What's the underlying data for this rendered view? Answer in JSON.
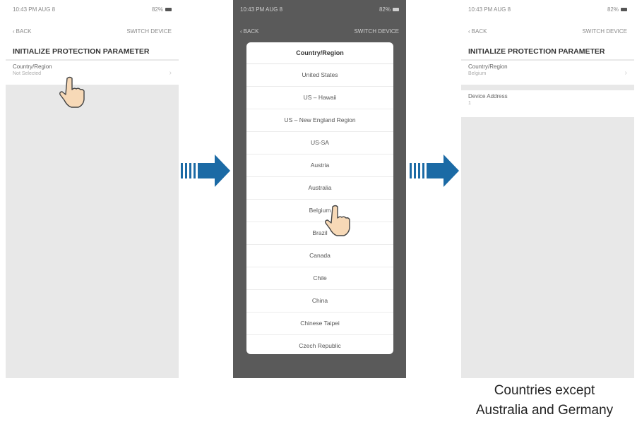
{
  "left_screen": {
    "status": {
      "left": "10:43 PM AUG 8",
      "right": "82%"
    },
    "nav": {
      "back_label": "BACK",
      "title": "SWITCH DEVICE"
    },
    "page_title": "INITIALIZE PROTECTION PARAMETER",
    "country_row": {
      "label": "Country/Region",
      "value": "Not Selected"
    }
  },
  "middle_screen": {
    "status": {
      "left": "10:43 PM AUG 8",
      "right": "82%"
    },
    "nav": {
      "back_label": "BACK",
      "title": "SWITCH DEVICE"
    },
    "modal_title": "Country/Region",
    "options": [
      "United States",
      "US – Hawaii",
      "US – New England Region",
      "US-SA",
      "Austria",
      "Australia",
      "Belgium",
      "Brazil",
      "Canada",
      "Chile",
      "China",
      "Chinese Taipei",
      "Czech Republic"
    ]
  },
  "right_screen": {
    "status": {
      "left": "10:43 PM AUG 8",
      "right": "82%"
    },
    "nav": {
      "back_label": "BACK",
      "title": "SWITCH DEVICE"
    },
    "page_title": "INITIALIZE PROTECTION PARAMETER",
    "country_row": {
      "label": "Country/Region",
      "value": "Belgium"
    },
    "device_address_row": {
      "label": "Device Address",
      "value": "1"
    }
  },
  "caption": {
    "line1": "Countries except",
    "line2": "Australia and Germany"
  },
  "colors": {
    "arrow": "#1b6aa5",
    "hand_fill": "#f7d9b7"
  }
}
